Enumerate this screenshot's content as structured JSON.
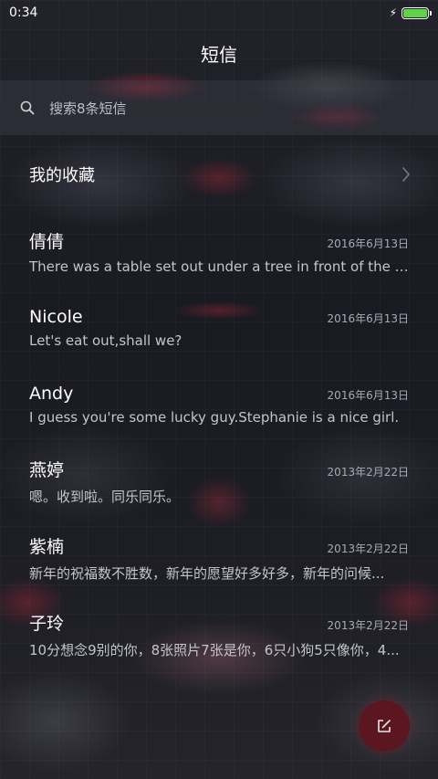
{
  "status_bar": {
    "time": "0:34",
    "charging_icon": "bolt-icon",
    "battery_level": 1.0,
    "battery_color": "#5fd24a"
  },
  "header": {
    "title": "短信"
  },
  "search": {
    "icon": "search-icon",
    "placeholder": "搜索8条短信"
  },
  "favorites": {
    "label": "我的收藏",
    "icon": "chevron-right-icon"
  },
  "conversations": [
    {
      "name": "倩倩",
      "date": "2016年6月13日",
      "preview": "There was a table set out under a tree in front of the ho..."
    },
    {
      "name": "Nicole",
      "date": "2016年6月13日",
      "preview": "Let's eat out,shall we?"
    },
    {
      "name": "Andy",
      "date": "2016年6月13日",
      "preview": "I guess you're some lucky guy.Stephanie is a nice girl."
    },
    {
      "name": "燕婷",
      "date": "2013年2月22日",
      "preview": "嗯。收到啦。同乐同乐。"
    },
    {
      "name": "紫楠",
      "date": "2013年2月22日",
      "preview": "新年的祝福数不胜数，新年的愿望好多好多，新年的问候..."
    },
    {
      "name": "子玲",
      "date": "2013年2月22日",
      "preview": "10分想念9别的你，8张照片7张是你，6只小狗5只像你，4..."
    }
  ],
  "compose_button": {
    "icon": "compose-icon",
    "color": "#5b1620"
  }
}
